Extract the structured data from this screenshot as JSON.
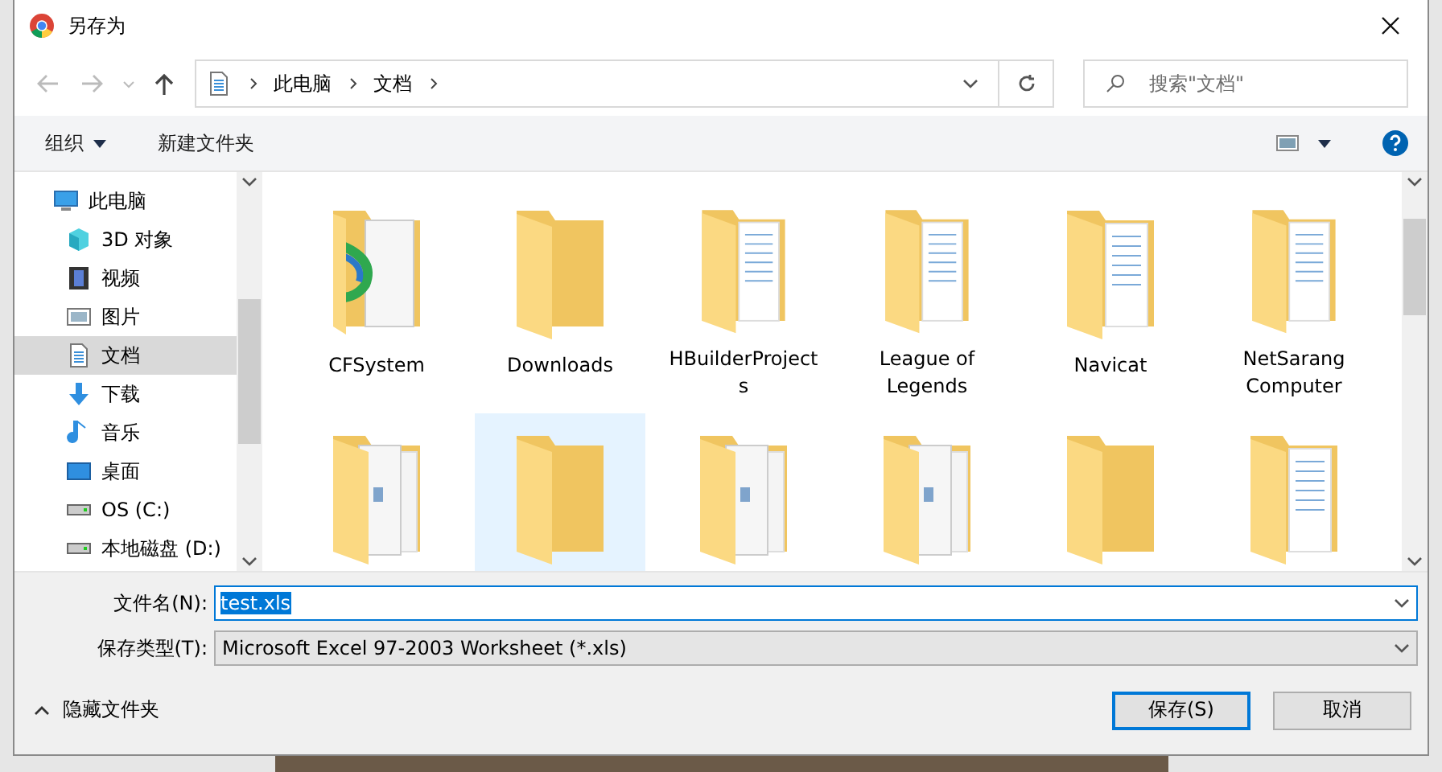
{
  "window": {
    "title": "另存为"
  },
  "address": {
    "breadcrumbs": [
      "此电脑",
      "文档"
    ]
  },
  "search": {
    "placeholder": "搜索\"文档\""
  },
  "toolbar": {
    "organize": "组织",
    "new_folder": "新建文件夹"
  },
  "sidebar": {
    "items": [
      {
        "label": "此电脑",
        "kind": "computer",
        "selected": false,
        "children": [
          {
            "label": "3D 对象",
            "kind": "cube",
            "selected": false
          },
          {
            "label": "视频",
            "kind": "video",
            "selected": false
          },
          {
            "label": "图片",
            "kind": "picture",
            "selected": false
          },
          {
            "label": "文档",
            "kind": "document",
            "selected": true
          },
          {
            "label": "下载",
            "kind": "download",
            "selected": false
          },
          {
            "label": "音乐",
            "kind": "music",
            "selected": false
          },
          {
            "label": "桌面",
            "kind": "desktop",
            "selected": false
          },
          {
            "label": "OS (C:)",
            "kind": "drive",
            "selected": false
          },
          {
            "label": "本地磁盘 (D:)",
            "kind": "drive",
            "selected": false
          }
        ]
      }
    ]
  },
  "folders": [
    {
      "name": "CFSystem",
      "kind": "media",
      "selected": false
    },
    {
      "name": "Downloads",
      "kind": "plain",
      "selected": false
    },
    {
      "name": "HBuilderProjects",
      "kind": "pages",
      "selected": false
    },
    {
      "name": "League of Legends",
      "kind": "pages",
      "selected": false
    },
    {
      "name": "Navicat",
      "kind": "pages",
      "selected": false
    },
    {
      "name": "NetSarang Computer",
      "kind": "pages",
      "selected": false
    },
    {
      "kind": "files",
      "selected": false
    },
    {
      "kind": "plain",
      "selected": true
    },
    {
      "kind": "files",
      "selected": false
    },
    {
      "kind": "files",
      "selected": false
    },
    {
      "kind": "plain",
      "selected": false
    },
    {
      "kind": "pages",
      "selected": false
    }
  ],
  "form": {
    "filename_label": "文件名(N):",
    "filename": "test.xls",
    "type_label": "保存类型(T):",
    "type": "Microsoft Excel 97-2003 Worksheet (*.xls)"
  },
  "footer": {
    "hide_folders": "隐藏文件夹",
    "save": "保存(S)",
    "cancel": "取消"
  }
}
